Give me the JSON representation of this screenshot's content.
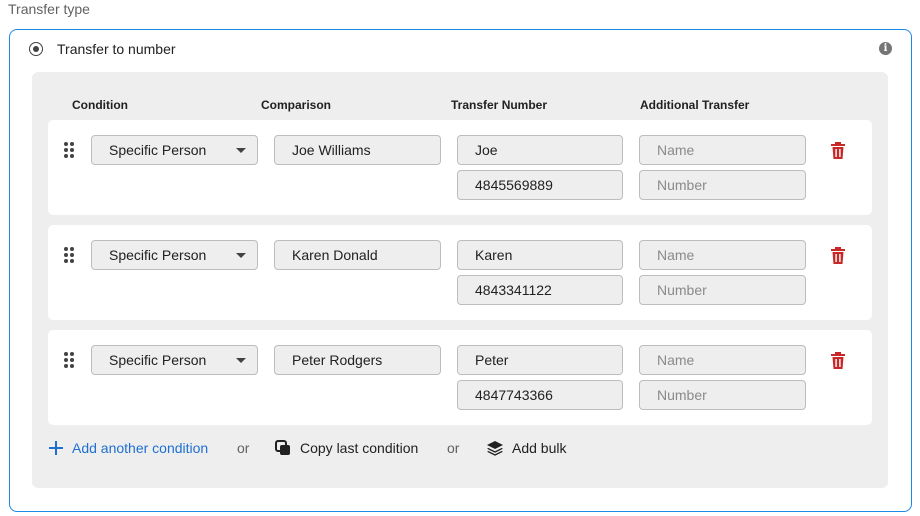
{
  "section_label": "Transfer type",
  "transfer_type": {
    "label": "Transfer to number",
    "selected": true
  },
  "columns": {
    "condition": "Condition",
    "comparison": "Comparison",
    "transfer_number": "Transfer Number",
    "additional_transfer": "Additional Transfer"
  },
  "rows": [
    {
      "condition": "Specific Person",
      "comparison": "Joe Williams",
      "transfer_name": "Joe",
      "transfer_number": "4845569889",
      "additional_name_placeholder": "Name",
      "additional_number_placeholder": "Number"
    },
    {
      "condition": "Specific Person",
      "comparison": "Karen Donald",
      "transfer_name": "Karen",
      "transfer_number": "4843341122",
      "additional_name_placeholder": "Name",
      "additional_number_placeholder": "Number"
    },
    {
      "condition": "Specific Person",
      "comparison": "Peter Rodgers",
      "transfer_name": "Peter",
      "transfer_number": "4847743366",
      "additional_name_placeholder": "Name",
      "additional_number_placeholder": "Number"
    }
  ],
  "actions": {
    "add_condition": "Add another condition",
    "or1": "or",
    "copy_last": "Copy last condition",
    "or2": "or",
    "add_bulk": "Add bulk"
  },
  "colors": {
    "accent": "#1e88e5",
    "link": "#1e6fd0",
    "delete": "#c62828",
    "panel": "#eeeeee"
  },
  "icons": {
    "info": "info-icon",
    "drag": "drag-handle-icon",
    "delete": "trash-icon",
    "add": "plus-icon",
    "copy": "copy-icon",
    "bulk": "layers-icon"
  }
}
